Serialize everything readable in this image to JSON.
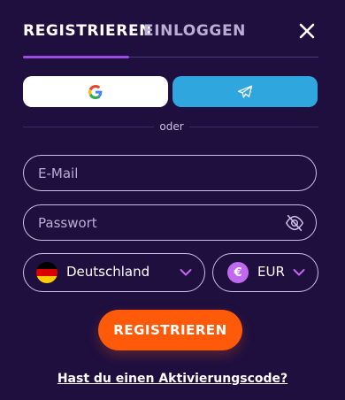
{
  "tabs": {
    "register": "REGISTRIEREN",
    "login": "EINLOGGEN",
    "active": "register"
  },
  "social": {
    "google_icon": "google-g-icon",
    "telegram_icon": "telegram-paper-plane-icon"
  },
  "divider_text": "oder",
  "form": {
    "email_placeholder": "E-Mail",
    "password_placeholder": "Passwort",
    "country": {
      "label": "Deutschland",
      "flag": "germany-flag-icon"
    },
    "currency": {
      "label": "EUR",
      "symbol": "€"
    }
  },
  "cta_label": "REGISTRIEREN",
  "activation_link": "Hast du einen Aktivierungscode?",
  "colors": {
    "background": "#1e0f3f",
    "accent_purple": "#9b4ce3",
    "telegram_blue": "#2fa7de",
    "cta_orange": "#ff5a0a",
    "currency_badge": "#c069f0"
  }
}
